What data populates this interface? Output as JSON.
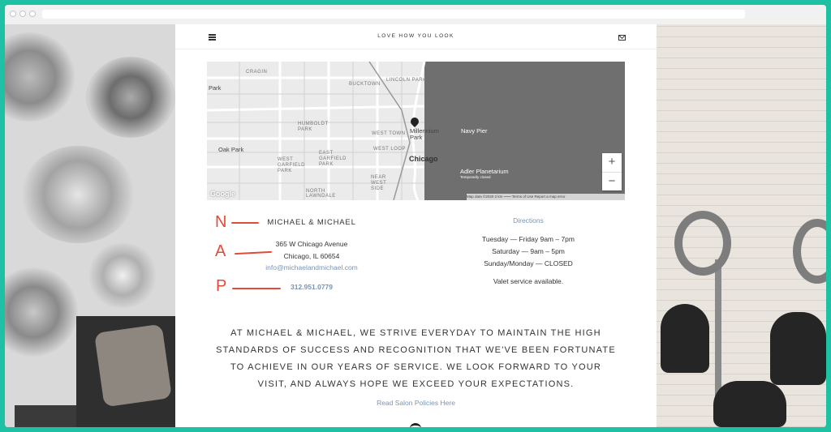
{
  "header": {
    "tagline": "LOVE HOW YOU LOOK"
  },
  "map": {
    "labels": [
      {
        "text": "Chicago",
        "cls": "big"
      },
      {
        "text": "Oak Park",
        "cls": "mid"
      },
      {
        "text": "Millennium Park",
        "cls": "mid"
      },
      {
        "text": "Navy Pier",
        "cls": "mid"
      },
      {
        "text": "Adler Planetarium",
        "cls": "mid"
      },
      {
        "text": "Temporarily closed",
        "cls": ""
      },
      {
        "text": "HUMBOLDT PARK",
        "cls": ""
      },
      {
        "text": "WEST TOWN",
        "cls": ""
      },
      {
        "text": "WEST LOOP",
        "cls": ""
      },
      {
        "text": "EAST GARFIELD PARK",
        "cls": ""
      },
      {
        "text": "WEST GARFIELD PARK",
        "cls": ""
      },
      {
        "text": "NEAR WEST SIDE",
        "cls": ""
      },
      {
        "text": "NORTH LAWNDALE",
        "cls": ""
      },
      {
        "text": "LINCOLN PARK",
        "cls": ""
      },
      {
        "text": "CRAGIN",
        "cls": ""
      },
      {
        "text": "BUCKTOWN",
        "cls": ""
      },
      {
        "text": "Park",
        "cls": "mid"
      }
    ],
    "zoom_in": "+",
    "zoom_out": "−",
    "attribution": "Map data ©2020   2 km ⎯⎯⎯⎯   Terms of Use   Report a map error",
    "google_logo": "Google"
  },
  "nap": {
    "letters": {
      "n": "N",
      "a": "A",
      "p": "P"
    },
    "business_name": "MICHAEL & MICHAEL",
    "address_line1": "365 W Chicago Avenue",
    "address_line2": "Chicago, IL 60654",
    "email": "info@michaelandmichael.com",
    "phone": "312.951.0779"
  },
  "hours": {
    "directions_label": "Directions",
    "lines": [
      "Tuesday — Friday 9am – 7pm",
      "Saturday — 9am – 5pm",
      "Sunday/Monday — CLOSED"
    ],
    "valet": "Valet service available."
  },
  "mission": "AT MICHAEL & MICHAEL, WE STRIVE EVERYDAY TO MAINTAIN THE HIGH STANDARDS OF SUCCESS AND RECOGNITION THAT WE'VE BEEN FORTUNATE TO ACHIEVE IN OUR YEARS OF SERVICE. WE LOOK FORWARD TO YOUR VISIT, AND ALWAYS HOPE WE EXCEED YOUR EXPECTATIONS.",
  "policies_link": "Read Salon Policies Here",
  "colors": {
    "frame": "#1ec1a4",
    "nap_annotation": "#e24a3a",
    "link": "#7a94b4",
    "lake": "#6f6f6f"
  }
}
